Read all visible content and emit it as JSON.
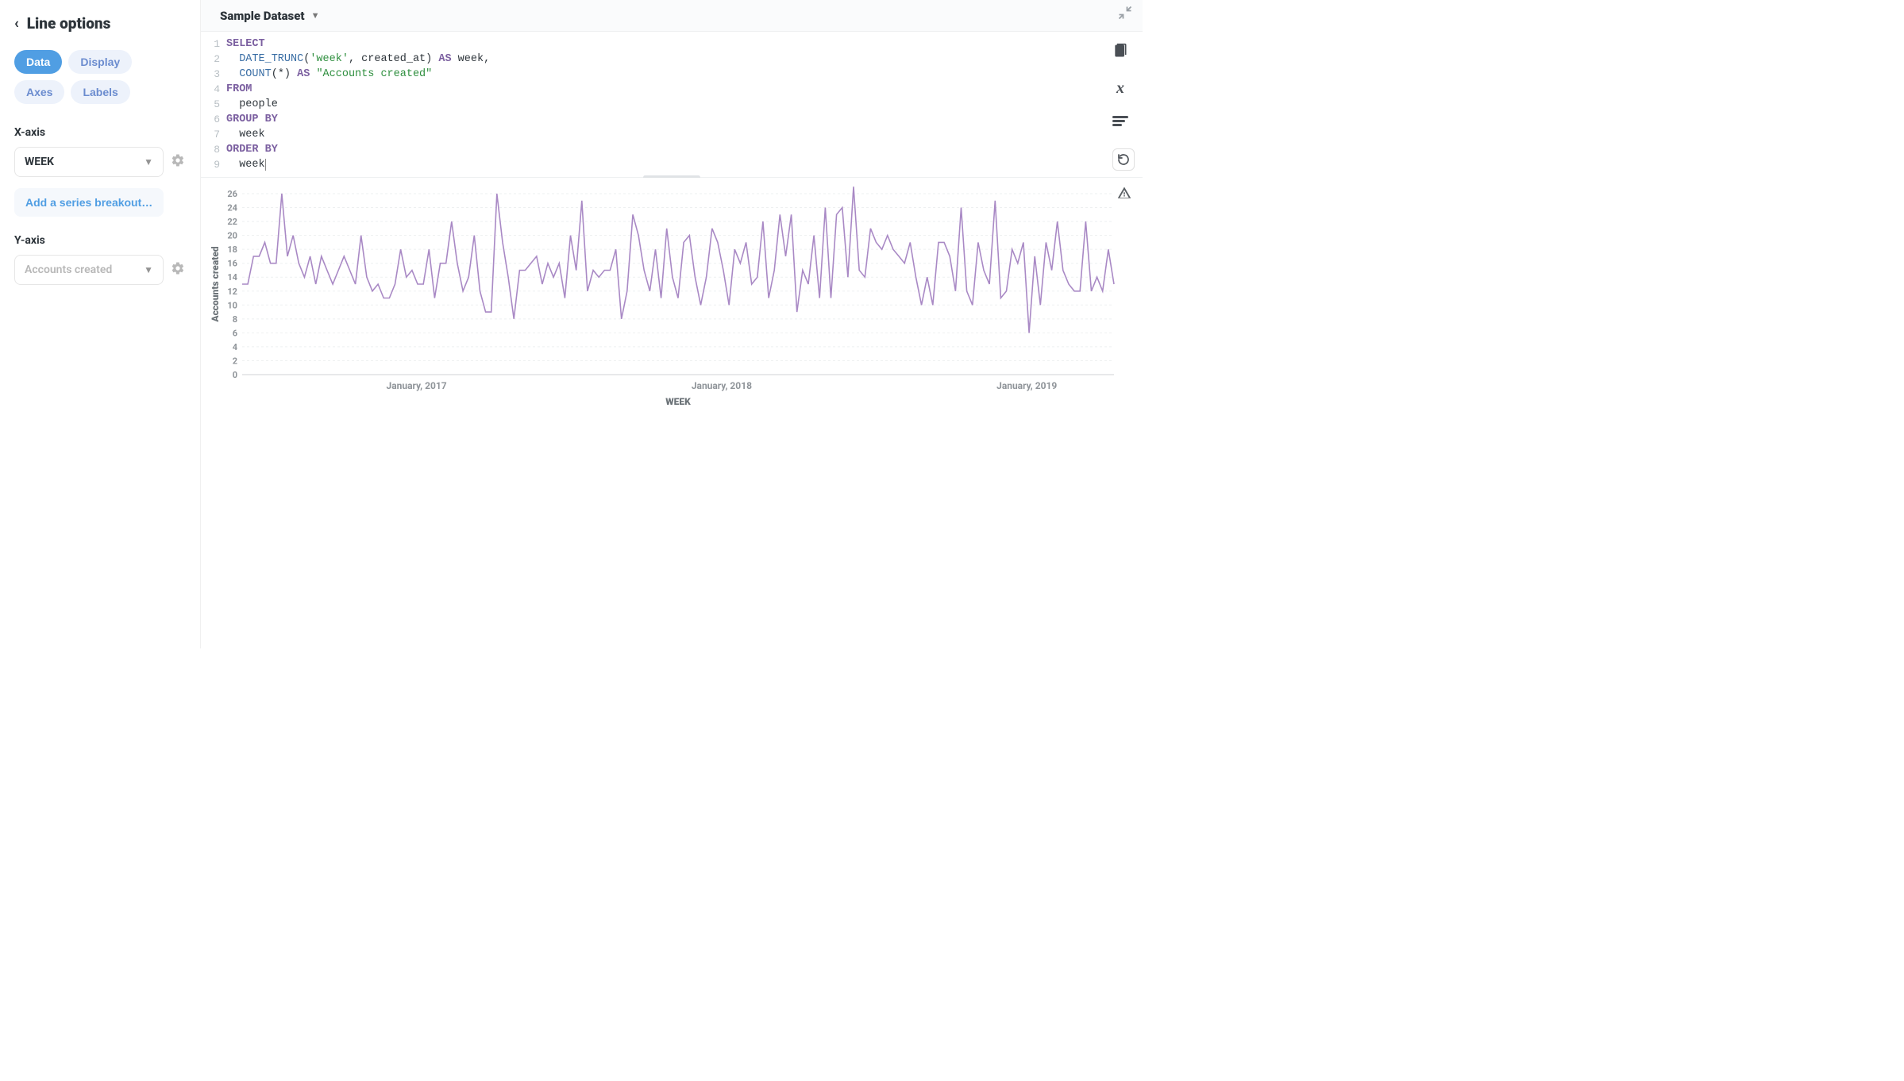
{
  "sidebar": {
    "title": "Line options",
    "tabs": [
      "Data",
      "Display",
      "Axes",
      "Labels"
    ],
    "active_tab": 0,
    "x_axis_label": "X-axis",
    "x_axis_value": "WEEK",
    "breakout_label": "Add a series breakout…",
    "y_axis_label": "Y-axis",
    "y_axis_value": "Accounts created"
  },
  "header": {
    "dataset_label": "Sample Dataset"
  },
  "editor": {
    "line_count": 9,
    "tokens": [
      [
        {
          "t": "SELECT",
          "c": "kw"
        }
      ],
      [
        {
          "t": "  "
        },
        {
          "t": "DATE_TRUNC",
          "c": "fn"
        },
        {
          "t": "("
        },
        {
          "t": "'week'",
          "c": "str"
        },
        {
          "t": ", created_at) "
        },
        {
          "t": "AS",
          "c": "kw"
        },
        {
          "t": " week,"
        }
      ],
      [
        {
          "t": "  "
        },
        {
          "t": "COUNT",
          "c": "fn"
        },
        {
          "t": "(*) "
        },
        {
          "t": "AS",
          "c": "kw"
        },
        {
          "t": " "
        },
        {
          "t": "\"Accounts created\"",
          "c": "str"
        }
      ],
      [
        {
          "t": "FROM",
          "c": "kw"
        }
      ],
      [
        {
          "t": "  people"
        }
      ],
      [
        {
          "t": "GROUP BY",
          "c": "kw"
        }
      ],
      [
        {
          "t": "  week"
        }
      ],
      [
        {
          "t": "ORDER BY",
          "c": "kw"
        }
      ],
      [
        {
          "t": "  week"
        }
      ]
    ]
  },
  "chart_data": {
    "type": "line",
    "title": "",
    "xlabel": "WEEK",
    "ylabel": "Accounts created",
    "ylim": [
      0,
      26
    ],
    "y_ticks": [
      0,
      2,
      4,
      6,
      8,
      10,
      12,
      14,
      16,
      18,
      20,
      22,
      24,
      26
    ],
    "x_ticks": [
      "January, 2017",
      "January, 2018",
      "January, 2019"
    ],
    "series": [
      {
        "name": "Accounts created",
        "color": "#a989c5",
        "values": [
          13,
          13,
          17,
          17,
          19,
          16,
          16,
          26,
          17,
          20,
          16,
          14,
          17,
          13,
          17,
          15,
          13,
          15,
          17,
          15,
          13,
          20,
          14,
          12,
          13,
          11,
          11,
          13,
          18,
          14,
          15,
          13,
          13,
          18,
          11,
          16,
          16,
          22,
          16,
          12,
          14,
          20,
          12,
          9,
          9,
          26,
          19,
          14,
          8,
          15,
          15,
          16,
          17,
          13,
          16,
          14,
          16,
          11,
          20,
          15,
          25,
          12,
          15,
          14,
          15,
          15,
          18,
          8,
          12,
          23,
          20,
          15,
          12,
          18,
          11,
          21,
          14,
          11,
          19,
          20,
          14,
          10,
          14,
          21,
          19,
          15,
          10,
          18,
          16,
          19,
          13,
          14,
          22,
          11,
          15,
          23,
          17,
          23,
          9,
          15,
          13,
          20,
          11,
          24,
          11,
          23,
          24,
          14,
          27,
          15,
          14,
          21,
          19,
          18,
          20,
          18,
          17,
          16,
          19,
          14,
          10,
          14,
          10,
          19,
          19,
          17,
          12,
          24,
          12,
          10,
          19,
          15,
          13,
          25,
          11,
          12,
          18,
          16,
          19,
          6,
          17,
          10,
          19,
          15,
          22,
          15,
          13,
          12,
          12,
          22,
          12,
          14,
          12,
          18,
          13
        ]
      }
    ]
  }
}
